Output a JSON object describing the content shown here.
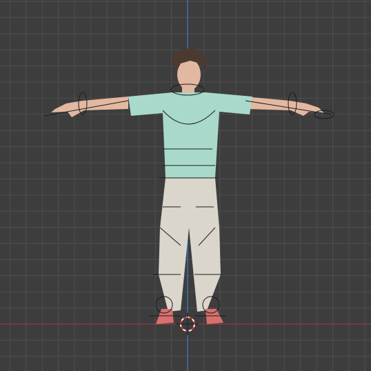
{
  "viewport": {
    "view": "front-orthographic",
    "background_color": "#3d3d3d",
    "grid_minor_color": "#464646",
    "grid_major_color": "#4f4f4f",
    "axis_x_color": "#8a3a45",
    "axis_z_color": "#3d6fb0",
    "cursor_icon": "3d-cursor-icon"
  },
  "character": {
    "skin_color": "#e2b8a0",
    "hair_color": "#4a3a30",
    "shirt_color": "#a9d9cb",
    "pants_color": "#dad6cc",
    "shoes_color": "#d8706e",
    "pose": "t-pose",
    "rig_overlay": "armature-controls"
  }
}
